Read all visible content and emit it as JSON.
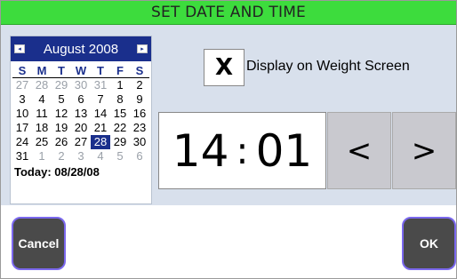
{
  "title": "SET DATE AND TIME",
  "calendar": {
    "month": "August 2008",
    "prev_icon": "left-arrow-icon",
    "next_icon": "right-arrow-icon",
    "weekdays": [
      "S",
      "M",
      "T",
      "W",
      "T",
      "F",
      "S"
    ],
    "weeks": [
      [
        "27",
        "28",
        "29",
        "30",
        "31",
        "1",
        "2"
      ],
      [
        "3",
        "4",
        "5",
        "6",
        "7",
        "8",
        "9"
      ],
      [
        "10",
        "11",
        "12",
        "13",
        "14",
        "15",
        "16"
      ],
      [
        "17",
        "18",
        "19",
        "20",
        "21",
        "22",
        "23"
      ],
      [
        "24",
        "25",
        "26",
        "27",
        "28",
        "29",
        "30"
      ],
      [
        "31",
        "1",
        "2",
        "3",
        "4",
        "5",
        "6"
      ]
    ],
    "selected_day": "28",
    "today_label": "Today: 08/28/08"
  },
  "display_checkbox": {
    "mark": "X",
    "label": "Display on Weight Screen",
    "checked": true
  },
  "time": {
    "hours": "14",
    "separator": ":",
    "minutes": "01"
  },
  "buttons": {
    "decrement": "<",
    "increment": ">",
    "cancel": "Cancel",
    "ok": "OK"
  },
  "colors": {
    "title_bar": "#3ddc3d",
    "calendar_header": "#1a2f8c",
    "button_border": "#7b68ee"
  }
}
